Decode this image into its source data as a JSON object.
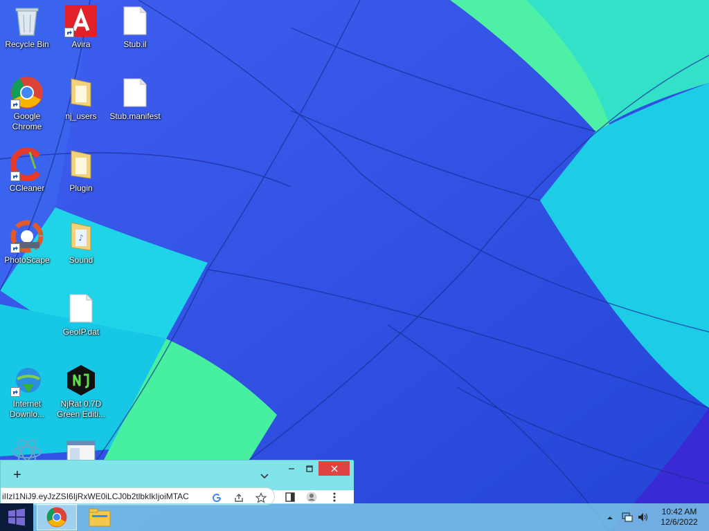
{
  "desktop": {
    "icons": [
      {
        "id": "recycle-bin",
        "label": "Recycle Bin"
      },
      {
        "id": "avira",
        "label": "Avira"
      },
      {
        "id": "stub-il",
        "label": "Stub.il"
      },
      {
        "id": "google-chrome",
        "label": "Google Chrome"
      },
      {
        "id": "nj-users",
        "label": "nj_users"
      },
      {
        "id": "stub-manifest",
        "label": "Stub.manifest"
      },
      {
        "id": "ccleaner",
        "label": "CCleaner"
      },
      {
        "id": "plugin",
        "label": "Plugin"
      },
      {
        "id": "photoscape",
        "label": "PhotoScape"
      },
      {
        "id": "sound",
        "label": "Sound"
      },
      {
        "id": "geoip-dat",
        "label": "GeoIP.dat"
      },
      {
        "id": "internet-download-manager",
        "label": "Internet Downlo..."
      },
      {
        "id": "njrat",
        "label": "NjRat 0.7D Green Editi..."
      }
    ]
  },
  "chrome_window": {
    "new_tab": "+",
    "url": "iIIzI1NiJ9.eyJzZSI6IjRxWE0iLCJ0b2tlbkIkIjoiMTAC"
  },
  "taskbar": {
    "time": "10:42 AM",
    "date": "12/6/2022"
  },
  "colors": {
    "accent_close": "#e04343",
    "wallpaper_blue": "#2f55e0",
    "wallpaper_cyan": "#18d6e8",
    "wallpaper_green": "#44ee9c"
  }
}
